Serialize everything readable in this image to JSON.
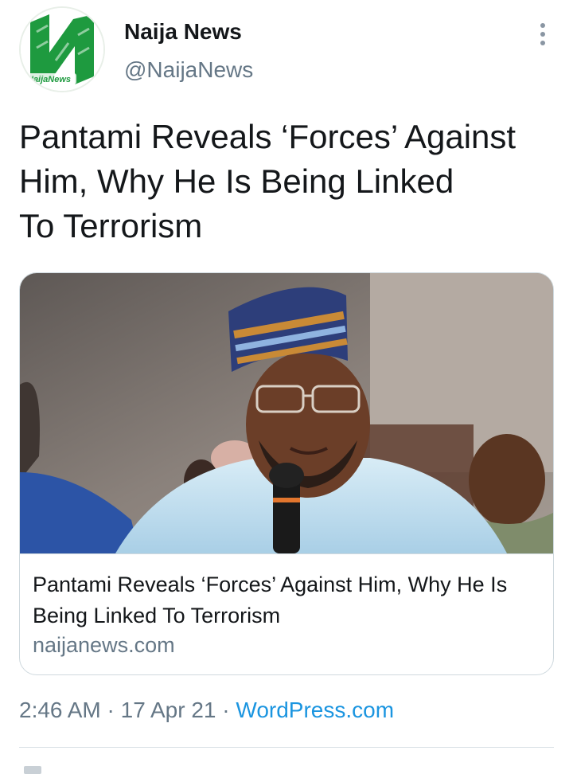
{
  "author": {
    "name": "Naija News",
    "handle": "@NaijaNews",
    "avatar_logo_text": "NaijaNews",
    "avatar_icon": "naija-news-logo"
  },
  "tweet": {
    "text_lines": [
      "Pantami Reveals ‘Forces’ Against",
      "Him, Why He Is Being Linked",
      "To Terrorism"
    ]
  },
  "card": {
    "title": "Pantami Reveals ‘Forces’ Against Him, Why He Is Being Linked To Terrorism",
    "domain": "naijanews.com"
  },
  "meta": {
    "time": "2:46 AM",
    "separator": " · ",
    "date": "17 Apr 21",
    "source": "WordPress.com"
  },
  "colors": {
    "brand_green": "#1e9a3f",
    "link_blue": "#1b95e0",
    "secondary_text": "#657786"
  },
  "icons": {
    "more": "more-vertical-icon"
  }
}
